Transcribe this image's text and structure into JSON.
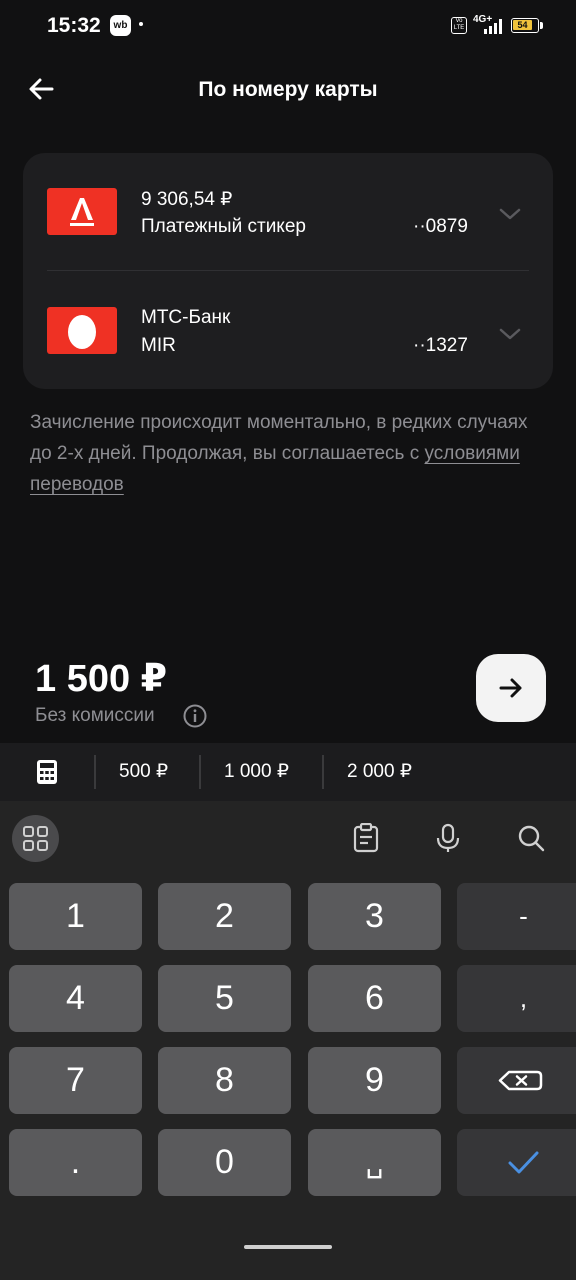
{
  "status_bar": {
    "time": "15:32",
    "app_badge": "wb",
    "network": "4G+",
    "volte": "Vo LTE",
    "battery": "54"
  },
  "header": {
    "title": "По номеру карты"
  },
  "cards": [
    {
      "line1": "9 306,54 ₽",
      "line2": "Платежный стикер",
      "digits": "··0879",
      "bank": "alfa"
    },
    {
      "line1": "МТС-Банк",
      "line2": "MIR",
      "digits": "··1327",
      "bank": "mts"
    }
  ],
  "info": {
    "text": "Зачисление происходит моментально, в редких случаях до 2-х дней. Продолжая, вы соглашаетесь с ",
    "link": "условиями переводов"
  },
  "amount": {
    "value": "1 500 ₽",
    "fee": "Без комиссии"
  },
  "quick_amounts": [
    "500 ₽",
    "1 000 ₽",
    "2 000 ₽"
  ],
  "keyboard": {
    "keys": [
      [
        "1",
        "2",
        "3",
        "-"
      ],
      [
        "4",
        "5",
        "6",
        ","
      ],
      [
        "7",
        "8",
        "9",
        ""
      ],
      [
        ".",
        "0",
        "␣",
        ""
      ]
    ]
  },
  "colors": {
    "accent_red": "#ef3124",
    "background": "#111112",
    "panel": "#1e1e20",
    "check_blue": "#4a90e2"
  }
}
